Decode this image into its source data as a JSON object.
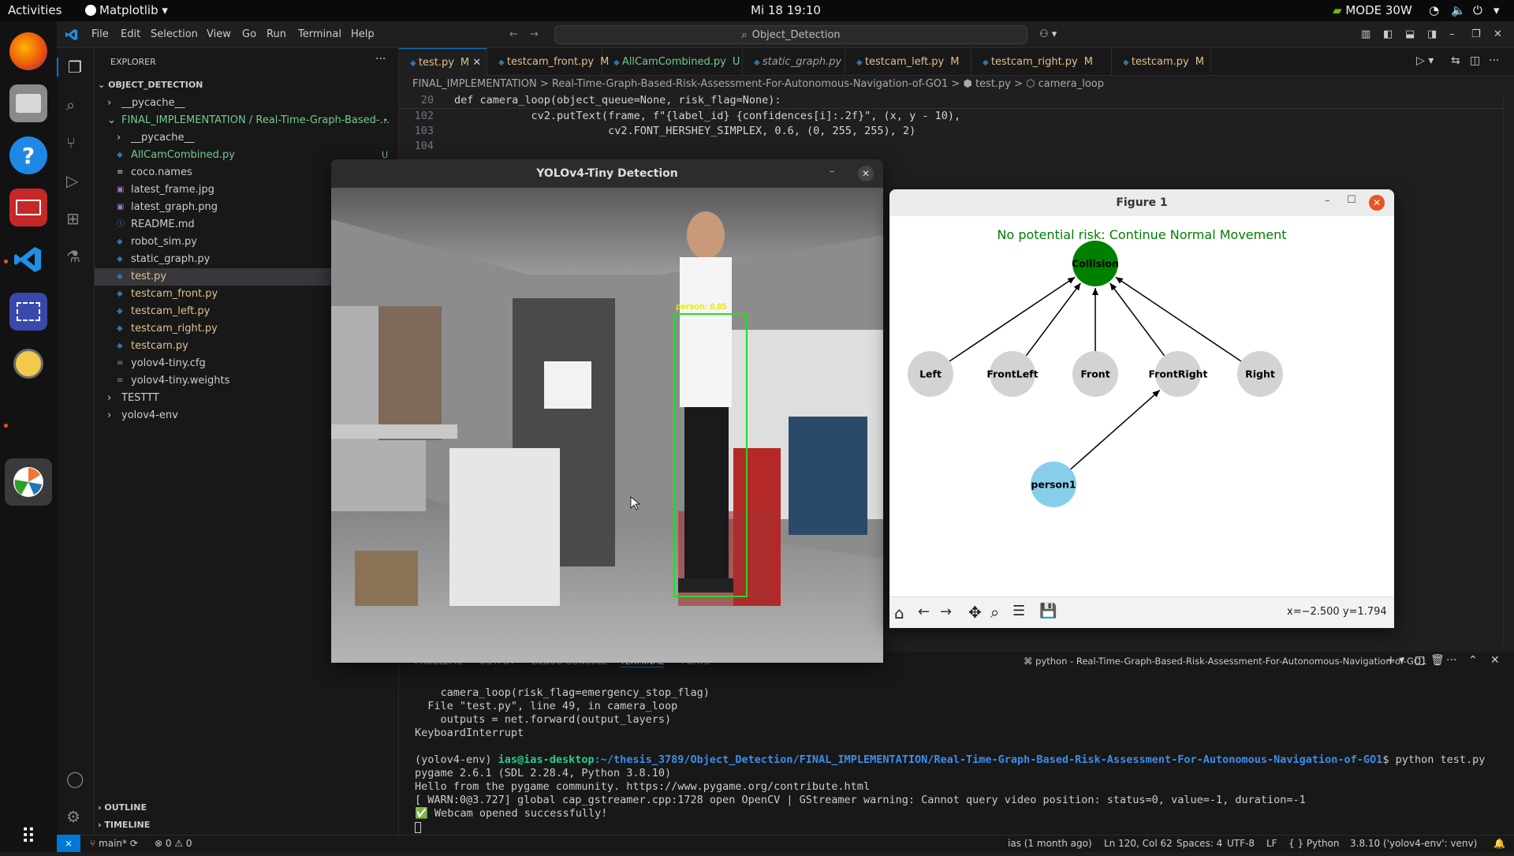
{
  "topbar": {
    "activities": "Activities",
    "app_menu": "Matplotlib",
    "clock": "Mi 18  19:10",
    "power_mode": "MODE 30W"
  },
  "vscode": {
    "menu": [
      "File",
      "Edit",
      "Selection",
      "View",
      "Go",
      "Run",
      "Terminal",
      "Help"
    ],
    "command_center": "Object_Detection",
    "explorer_title": "EXPLORER",
    "root": "OBJECT_DETECTION",
    "tree": [
      {
        "label": "__pycache__",
        "type": "folder",
        "collapsed": true,
        "indent": 1,
        "color": "#cccccc",
        "badge": ""
      },
      {
        "label": "FINAL_IMPLEMENTATION / Real-Time-Graph-Based-...",
        "type": "folder",
        "collapsed": false,
        "indent": 1,
        "color": "#73c991",
        "badge": "•"
      },
      {
        "label": "__pycache__",
        "type": "folder",
        "collapsed": true,
        "indent": 2,
        "color": "#cccccc",
        "badge": ""
      },
      {
        "label": "AllCamCombined.py",
        "type": "py",
        "indent": 2,
        "color": "#73c991",
        "badge": "U"
      },
      {
        "label": "coco.names",
        "type": "txt",
        "indent": 2,
        "color": "#cccccc",
        "badge": ""
      },
      {
        "label": "latest_frame.jpg",
        "type": "img",
        "indent": 2,
        "color": "#cccccc",
        "badge": ""
      },
      {
        "label": "latest_graph.png",
        "type": "img",
        "indent": 2,
        "color": "#cccccc",
        "badge": ""
      },
      {
        "label": "README.md",
        "type": "md",
        "indent": 2,
        "color": "#cccccc",
        "badge": ""
      },
      {
        "label": "robot_sim.py",
        "type": "py",
        "indent": 2,
        "color": "#cccccc",
        "badge": ""
      },
      {
        "label": "static_graph.py",
        "type": "py",
        "indent": 2,
        "color": "#cccccc",
        "badge": ""
      },
      {
        "label": "test.py",
        "type": "py",
        "indent": 2,
        "color": "#e2c08d",
        "badge": "M",
        "selected": true
      },
      {
        "label": "testcam_front.py",
        "type": "py",
        "indent": 2,
        "color": "#e2c08d",
        "badge": "M"
      },
      {
        "label": "testcam_left.py",
        "type": "py",
        "indent": 2,
        "color": "#e2c08d",
        "badge": "M"
      },
      {
        "label": "testcam_right.py",
        "type": "py",
        "indent": 2,
        "color": "#e2c08d",
        "badge": "M"
      },
      {
        "label": "testcam.py",
        "type": "py",
        "indent": 2,
        "color": "#e2c08d",
        "badge": "M"
      },
      {
        "label": "yolov4-tiny.cfg",
        "type": "cfg",
        "indent": 2,
        "color": "#cccccc",
        "badge": ""
      },
      {
        "label": "yolov4-tiny.weights",
        "type": "bin",
        "indent": 2,
        "color": "#cccccc",
        "badge": ""
      },
      {
        "label": "TESTTT",
        "type": "folder",
        "collapsed": true,
        "indent": 1,
        "color": "#cccccc",
        "badge": ""
      },
      {
        "label": "yolov4-env",
        "type": "folder",
        "collapsed": true,
        "indent": 1,
        "color": "#cccccc",
        "badge": ""
      }
    ],
    "outline": "OUTLINE",
    "timeline": "TIMELINE",
    "tabs": [
      {
        "label": "test.py",
        "mod": "M",
        "active": true,
        "italic": false
      },
      {
        "label": "testcam_front.py",
        "mod": "M",
        "active": false,
        "italic": false
      },
      {
        "label": "AllCamCombined.py",
        "mod": "U",
        "active": false,
        "italic": false
      },
      {
        "label": "static_graph.py",
        "mod": "",
        "active": false,
        "italic": true
      },
      {
        "label": "testcam_left.py",
        "mod": "M",
        "active": false,
        "italic": false
      },
      {
        "label": "testcam_right.py",
        "mod": "M",
        "active": false,
        "italic": false
      },
      {
        "label": "testcam.py",
        "mod": "M",
        "active": false,
        "italic": false
      }
    ],
    "breadcrumbs": "FINAL_IMPLEMENTATION > Real-Time-Graph-Based-Risk-Assessment-For-Autonomous-Navigation-of-GO1 > ⬢ test.py > ⬡ camera_loop",
    "code": [
      {
        "ln": "20",
        "text": "def camera_loop(object_queue=None, risk_flag=None):"
      },
      {
        "ln": "102",
        "text": "            cv2.putText(frame, f\"{label_id} {confidences[i]:.2f}\", (x, y - 10),"
      },
      {
        "ln": "103",
        "text": "                        cv2.FONT_HERSHEY_SIMPLEX, 0.6, (0, 255, 255), 2)"
      },
      {
        "ln": "104",
        "text": ""
      }
    ],
    "panel_tabs": [
      "PROBLEMS",
      "OUTPUT",
      "DEBUG CONSOLE",
      "TERMINAL",
      "PORTS"
    ],
    "terminal_title": "python - Real-Time-Graph-Based-Risk-Assessment-For-Autonomous-Navigation-of-GO1",
    "terminal_lines": [
      {
        "text": "    camera_loop(risk_flag=emergency_stop_flag)",
        "color": "#cccccc"
      },
      {
        "text": "  File \"test.py\", line 49, in camera_loop",
        "color": "#cccccc"
      },
      {
        "text": "    outputs = net.forward(output_layers)",
        "color": "#cccccc"
      },
      {
        "text": "KeyboardInterrupt",
        "color": "#cccccc"
      },
      {
        "text": "",
        "color": "#cccccc"
      },
      {
        "text": "(yolov4-env) ",
        "color": "#cccccc",
        "user": "ias@ias-desktop",
        "path": ":~/thesis_3789/Object_Detection/FINAL_IMPLEMENTATION/Real-Time-Graph-Based-Risk-Assessment-For-Autonomous-Navigation-of-GO1",
        "cmd": "$ python test.py"
      },
      {
        "text": "pygame 2.6.1 (SDL 2.28.4, Python 3.8.10)",
        "color": "#cccccc"
      },
      {
        "text": "Hello from the pygame community. https://www.pygame.org/contribute.html",
        "color": "#cccccc"
      },
      {
        "text": "[ WARN:0@3.727] global cap_gstreamer.cpp:1728 open OpenCV | GStreamer warning: Cannot query video position: status=0, value=-1, duration=-1",
        "color": "#cccccc"
      },
      {
        "text": "✅ Webcam opened successfully!",
        "color": "#cccccc"
      }
    ],
    "status": {
      "branch": "main*",
      "problems": "⊗ 0 ⚠ 0",
      "blame": "ias (1 month ago)",
      "position": "Ln 120, Col 62",
      "spaces": "Spaces: 4",
      "encoding": "UTF-8",
      "eol": "LF",
      "language": "{ } Python",
      "interpreter": "3.8.10 ('yolov4-env': venv)"
    }
  },
  "yolo_window": {
    "title": "YOLOv4-Tiny Detection",
    "detection_label": "person: 0.85",
    "box_color": "#22dd22",
    "label_color": "#e8e800"
  },
  "figure_window": {
    "title": "Figure 1",
    "status_text": "No potential risk: Continue Normal Movement",
    "status_color": "#008000",
    "coords": "x=−2.500 y=1.794",
    "nodes": [
      {
        "id": "Collision",
        "color": "#008000"
      },
      {
        "id": "Left",
        "color": "#d3d3d3"
      },
      {
        "id": "FrontLeft",
        "color": "#d3d3d3"
      },
      {
        "id": "Front",
        "color": "#d3d3d3"
      },
      {
        "id": "FrontRight",
        "color": "#d3d3d3"
      },
      {
        "id": "Right",
        "color": "#d3d3d3"
      },
      {
        "id": "person1",
        "color": "#87ceeb"
      }
    ],
    "edges": [
      [
        "Left",
        "Collision"
      ],
      [
        "FrontLeft",
        "Collision"
      ],
      [
        "Front",
        "Collision"
      ],
      [
        "FrontRight",
        "Collision"
      ],
      [
        "Right",
        "Collision"
      ],
      [
        "person1",
        "FrontRight"
      ]
    ]
  }
}
